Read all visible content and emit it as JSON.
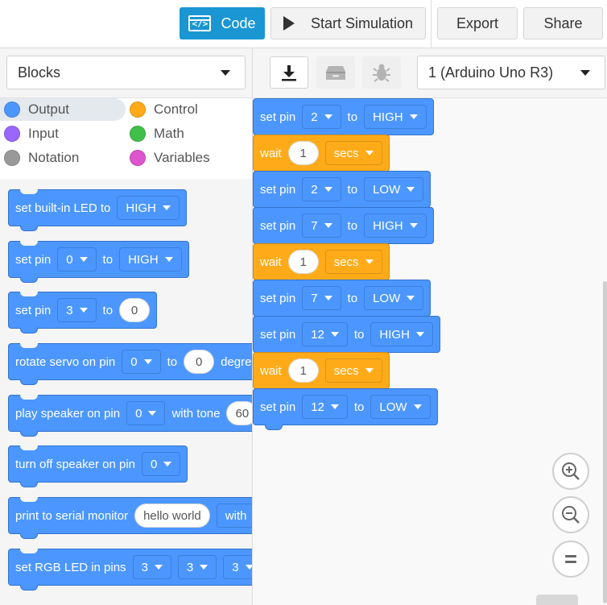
{
  "toolbar": {
    "code_label": "Code",
    "code_icon_glyph": "</>",
    "start_simulation_label": "Start Simulation",
    "export_label": "Export",
    "share_label": "Share"
  },
  "subbar": {
    "blocks_select_value": "Blocks",
    "board_select_value": "1 (Arduino Uno R3)"
  },
  "categories": [
    {
      "label": "Output",
      "color": "#4c97ff"
    },
    {
      "label": "Control",
      "color": "#ffab19"
    },
    {
      "label": "Input",
      "color": "#9966ff"
    },
    {
      "label": "Math",
      "color": "#40bf4a"
    },
    {
      "label": "Notation",
      "color": "#999999"
    },
    {
      "label": "Variables",
      "color": "#dd55cc"
    }
  ],
  "palette": {
    "b1": {
      "text": "set built-in LED to",
      "d1": "HIGH"
    },
    "b2": {
      "t1": "set pin",
      "d1": "0",
      "t2": "to",
      "d2": "HIGH"
    },
    "b3": {
      "t1": "set pin",
      "d1": "3",
      "t2": "to",
      "v1": "0"
    },
    "b4": {
      "t1": "rotate servo on pin",
      "d1": "0",
      "t2": "to",
      "v1": "0",
      "t3": "degrees"
    },
    "b5": {
      "t1": "play speaker on pin",
      "d1": "0",
      "t2": "with tone",
      "v1": "60"
    },
    "b6": {
      "t1": "turn off speaker on pin",
      "d1": "0"
    },
    "b7": {
      "t1": "print to serial monitor",
      "v1": "hello world",
      "t2": "with"
    },
    "b8": {
      "t1": "set RGB LED in pins",
      "d1": "3",
      "d2": "3",
      "d3": "3"
    }
  },
  "script": {
    "s1": {
      "t1": "set pin",
      "pin": "2",
      "t2": "to",
      "state": "HIGH"
    },
    "s2": {
      "t1": "wait",
      "v1": "1",
      "unit": "secs"
    },
    "s3": {
      "t1": "set pin",
      "pin": "2",
      "t2": "to",
      "state": "LOW"
    },
    "s4": {
      "t1": "set pin",
      "pin": "7",
      "t2": "to",
      "state": "HIGH"
    },
    "s5": {
      "t1": "wait",
      "v1": "1",
      "unit": "secs"
    },
    "s6": {
      "t1": "set pin",
      "pin": "7",
      "t2": "to",
      "state": "LOW"
    },
    "s7": {
      "t1": "set pin",
      "pin": "12",
      "t2": "to",
      "state": "HIGH"
    },
    "s8": {
      "t1": "wait",
      "v1": "1",
      "unit": "secs"
    },
    "s9": {
      "t1": "set pin",
      "pin": "12",
      "t2": "to",
      "state": "LOW"
    }
  },
  "icons": {
    "code": "code-icon",
    "play": "play-icon",
    "download": "download-icon",
    "archive": "archive-icon",
    "debug": "bug-icon",
    "zoom_in": "zoom-in-icon",
    "zoom_out": "zoom-out-icon",
    "zoom_reset": "zoom-reset-icon"
  },
  "colors": {
    "accent": "#1a96d3",
    "output_block": "#4c97ff",
    "control_block": "#ffab19"
  }
}
